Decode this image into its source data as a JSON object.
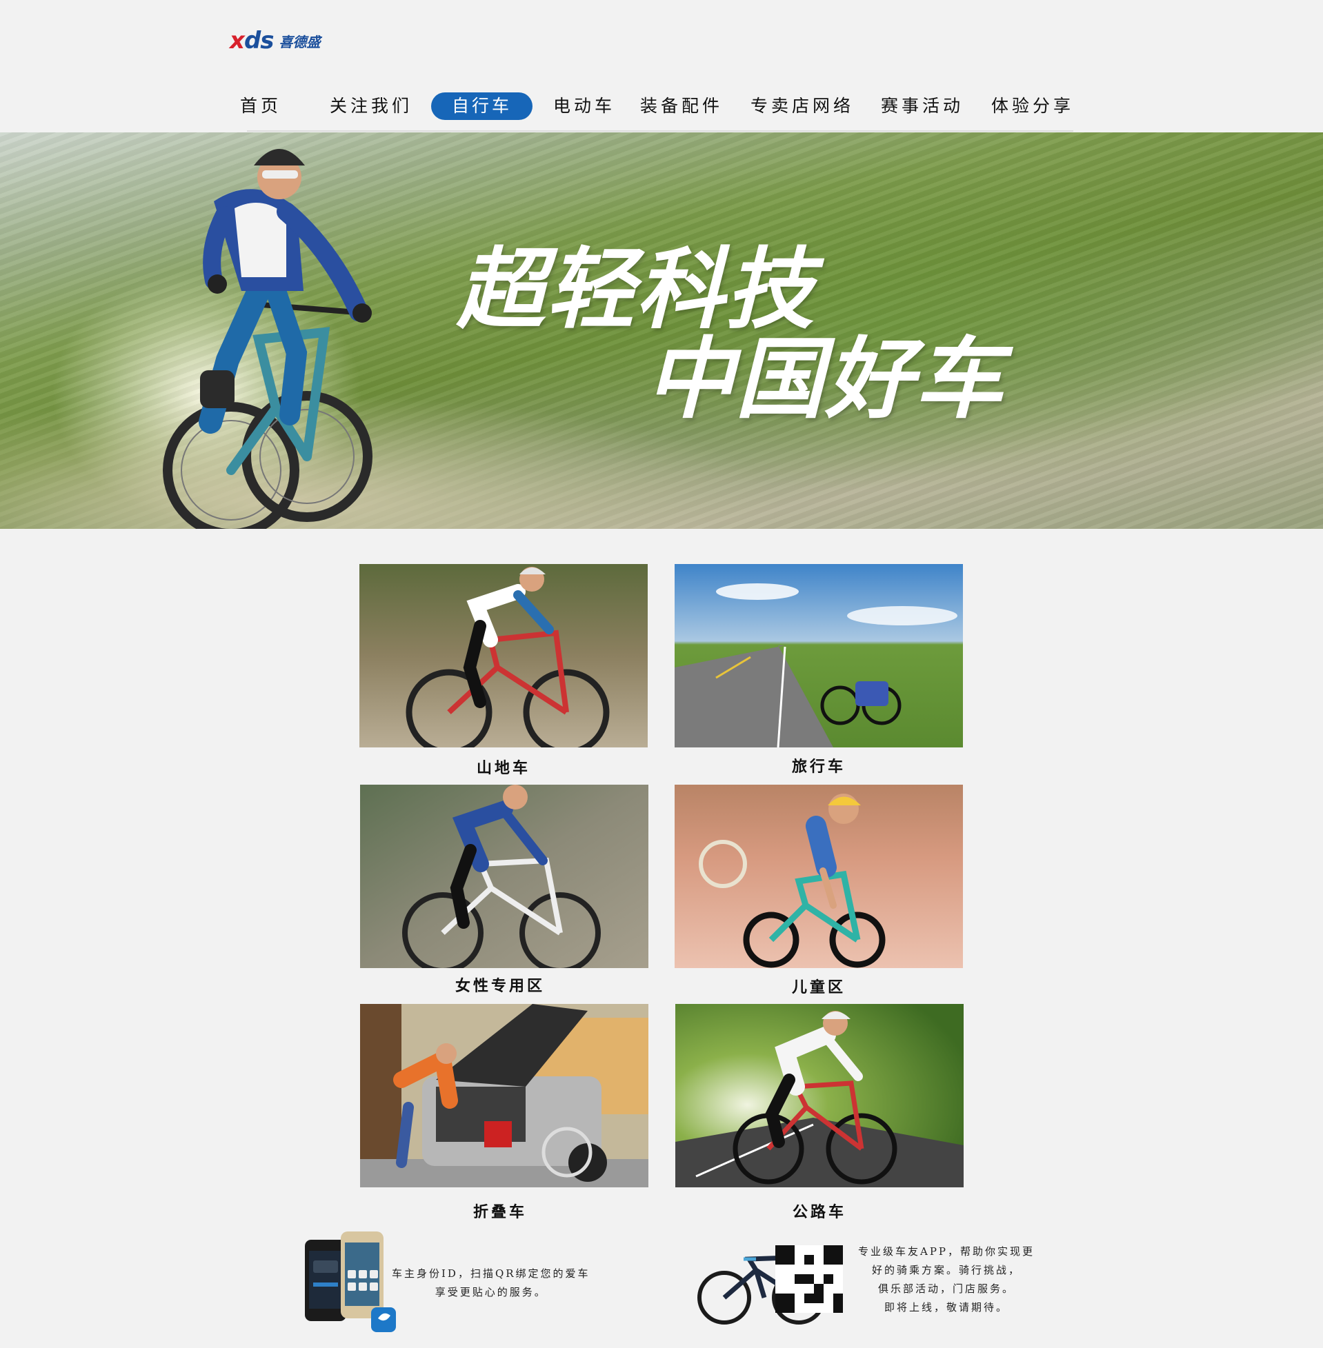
{
  "header": {
    "logo_mark": {
      "x": "x",
      "ds": "ds"
    },
    "logo_name": "喜德盛",
    "accent_color": "#1766b8",
    "brand_red": "#d8212c"
  },
  "nav": {
    "items": [
      {
        "label": "首页",
        "active": false
      },
      {
        "label": "关注我们",
        "active": false
      },
      {
        "label": "自行车",
        "active": true
      },
      {
        "label": "电动车",
        "active": false
      },
      {
        "label": "装备配件",
        "active": false
      },
      {
        "label": "专卖店网络",
        "active": false
      },
      {
        "label": "赛事活动",
        "active": false
      },
      {
        "label": "体验分享",
        "active": false
      }
    ]
  },
  "hero": {
    "title_line1": "超轻科技",
    "title_line2": "中国好车"
  },
  "categories": [
    {
      "label": "山地车",
      "icon": "mountain-bike-photo"
    },
    {
      "label": "旅行车",
      "icon": "touring-bike-photo"
    },
    {
      "label": "女性专用区",
      "icon": "women-rider-photo"
    },
    {
      "label": "儿童区",
      "icon": "kids-bike-photo"
    },
    {
      "label": "折叠车",
      "icon": "folding-bike-photo"
    },
    {
      "label": "公路车",
      "icon": "road-bike-photo"
    }
  ],
  "promos": {
    "id_service": {
      "line1": "车主身份ID，扫描QR绑定您的爱车",
      "line2": "享受更贴心的服务。",
      "icon": "smartphone-app-icon"
    },
    "app": {
      "line1": "专业级车友APP，帮助你实现更",
      "line2": "好的骑乘方案。骑行挑战，",
      "line3": "俱乐部活动，门店服务。",
      "line4": "即将上线，敬请期待。",
      "icon": "qr-code-icon"
    }
  }
}
